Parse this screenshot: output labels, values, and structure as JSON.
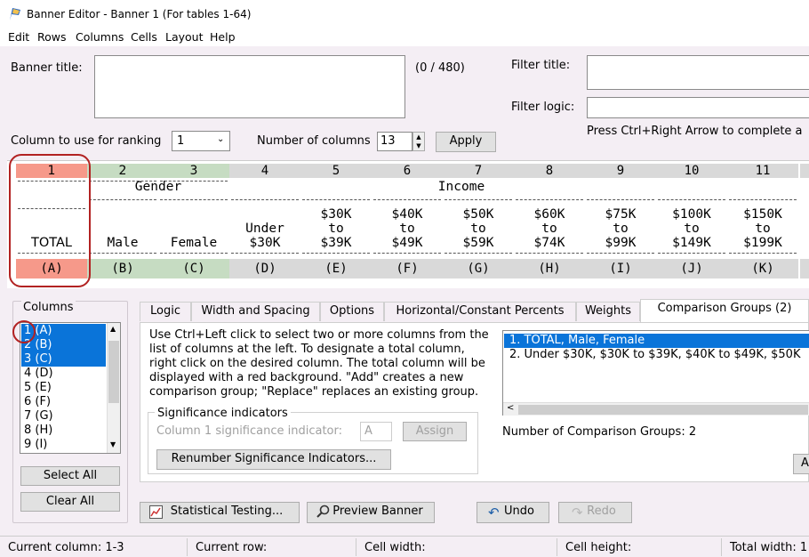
{
  "window": {
    "title": "Banner Editor - Banner 1 (For tables 1-64)"
  },
  "menu": [
    "Edit",
    "Rows",
    "Columns",
    "Cells",
    "Layout",
    "Help"
  ],
  "banner": {
    "title_label": "Banner title:",
    "counter": "(0 / 480)"
  },
  "filter": {
    "title_label": "Filter title:",
    "logic_label": "Filter logic:",
    "hint": "Press Ctrl+Right Arrow to complete a"
  },
  "ranking": {
    "label": "Column to use for ranking",
    "value": "1"
  },
  "num_columns": {
    "label": "Number of columns",
    "value": "13"
  },
  "apply_label": "Apply",
  "grid": {
    "groups": {
      "gender": "Gender",
      "income": "Income"
    },
    "columns": [
      {
        "num": "1",
        "l1": "",
        "l2": "",
        "l3": "TOTAL",
        "letter": "(A)"
      },
      {
        "num": "2",
        "l1": "",
        "l2": "",
        "l3": "Male",
        "letter": "(B)"
      },
      {
        "num": "3",
        "l1": "",
        "l2": "",
        "l3": "Female",
        "letter": "(C)"
      },
      {
        "num": "4",
        "l1": "",
        "l2": "Under",
        "l3": "$30K",
        "letter": "(D)"
      },
      {
        "num": "5",
        "l1": "$30K",
        "l2": "to",
        "l3": "$39K",
        "letter": "(E)"
      },
      {
        "num": "6",
        "l1": "$40K",
        "l2": "to",
        "l3": "$49K",
        "letter": "(F)"
      },
      {
        "num": "7",
        "l1": "$50K",
        "l2": "to",
        "l3": "$59K",
        "letter": "(G)"
      },
      {
        "num": "8",
        "l1": "$60K",
        "l2": "to",
        "l3": "$74K",
        "letter": "(H)"
      },
      {
        "num": "9",
        "l1": "$75K",
        "l2": "to",
        "l3": "$99K",
        "letter": "(I)"
      },
      {
        "num": "10",
        "l1": "$100K",
        "l2": "to",
        "l3": "$149K",
        "letter": "(J)"
      },
      {
        "num": "11",
        "l1": "$150K",
        "l2": "to",
        "l3": "$199K",
        "letter": "(K)"
      }
    ]
  },
  "columns_list": {
    "label": "Columns",
    "items": [
      "1 (A)",
      "2 (B)",
      "3 (C)",
      "4 (D)",
      "5 (E)",
      "6 (F)",
      "7 (G)",
      "8 (H)",
      "9 (I)"
    ],
    "select_all": "Select All",
    "clear_all": "Clear All"
  },
  "tabs": [
    "Logic",
    "Width and Spacing",
    "Options",
    "Horizontal/Constant Percents",
    "Weights",
    "Comparison Groups (2)"
  ],
  "comparison": {
    "instructions": [
      "Use Ctrl+Left click to select two or more columns from the",
      "list of columns at the left. To designate a total column,",
      "right click on the desired column. The total column will be",
      "displayed with a red background. \"Add\" creates a new",
      "comparison group; \"Replace\" replaces an existing group."
    ],
    "groups": [
      "1. TOTAL, Male, Female",
      "2. Under $30K, $30K to $39K, $40K to $49K, $50K"
    ],
    "count": "Number of Comparison Groups: 2",
    "sig_legend": "Significance indicators",
    "sig_label": "Column 1 significance indicator:",
    "sig_value": "A",
    "assign": "Assign",
    "renumber": "Renumber Significance Indicators...",
    "add_partial": "A"
  },
  "footer_buttons": {
    "stat": "Statistical Testing...",
    "preview": "Preview Banner",
    "undo": "Undo",
    "redo": "Redo"
  },
  "status": {
    "column": "Current column: 1-3",
    "row": "Current row:",
    "width": "Cell width:",
    "height": "Cell height:",
    "total": "Total width: 1"
  },
  "colors": {
    "total_col": "#f6998a",
    "group_col": "#c6dcc2",
    "header_gray": "#d9d9d9",
    "selection": "#0a74d9",
    "highlight_circle": "#b22222"
  }
}
